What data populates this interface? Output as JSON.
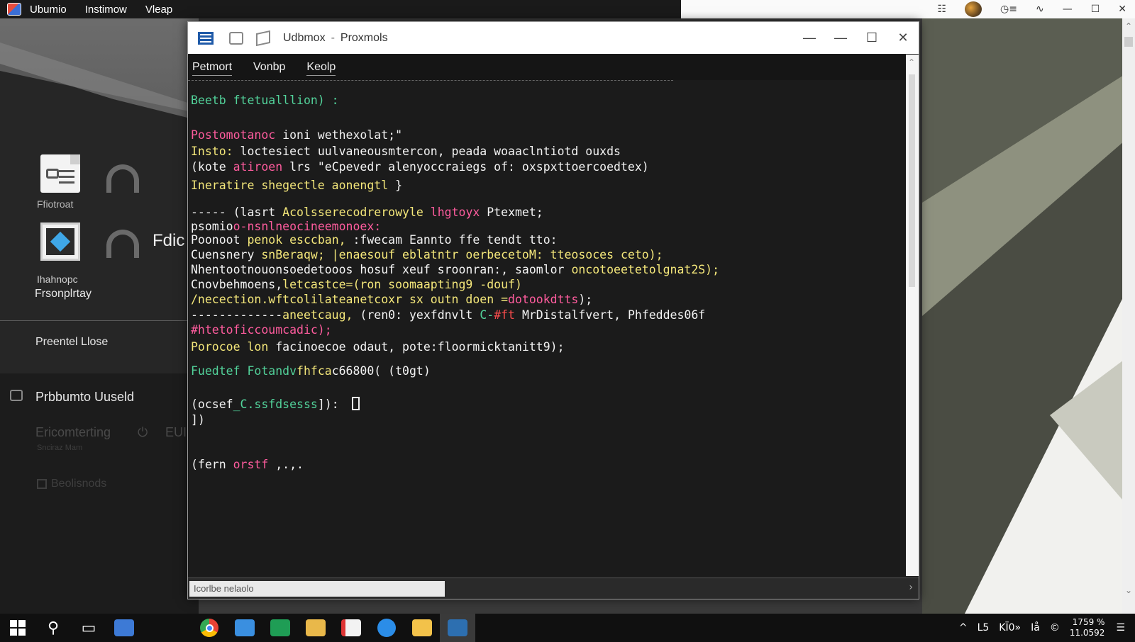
{
  "topbar": {
    "menus": [
      "Ubumio",
      "Instimow",
      "Vleap"
    ]
  },
  "desktop": {
    "icons": [
      {
        "label": "Ffiotroat"
      },
      {
        "label_line1": "Ihahnopc",
        "label_line2": "Frsonplrtay"
      }
    ],
    "side_text": "Fdic",
    "panel_item": "Preentel Llose",
    "section": {
      "title": "Prbbumto Uuseld",
      "dim_item": "Ericomterting",
      "dim_suffix": "EUI",
      "dim_sub": "Snciraz Mam",
      "dim_check": "Beolisnods"
    }
  },
  "window": {
    "title": "Udbmox",
    "separator": "-",
    "subtitle": "Proxmols",
    "menu": [
      "Petmort",
      "Vonbp",
      "Keolp"
    ],
    "status_field": "Icorlbe nelaolo",
    "terminal": {
      "lines": [
        [
          {
            "t": "Beetb ftetualllion) :",
            "c": "green"
          }
        ],
        [
          {
            "t": "Postomotanoc ",
            "c": "pink"
          },
          {
            "t": "ioni wethexolat;\"",
            "c": "white"
          }
        ],
        [
          {
            "t": "Insto: ",
            "c": "yellow"
          },
          {
            "t": "loctesiect uulvaneousmtercon, peada woaaclntiotd ouxds",
            "c": "white"
          }
        ],
        [
          {
            "t": "(kote ",
            "c": "white"
          },
          {
            "t": "atiroen ",
            "c": "pink"
          },
          {
            "t": "lrs \"eCpevedr alenyoccraiegs of: oxspxttoercoedtex)",
            "c": "white"
          }
        ],
        [
          {
            "t": "Ineratire shegectle aonengtl",
            "c": "yellow"
          },
          {
            "t": " }",
            "c": "white"
          }
        ],
        [
          {
            "t": "----- ",
            "c": "white"
          },
          {
            "t": "(lasrt ",
            "c": "white"
          },
          {
            "t": "Acolsserecodrerowyle ",
            "c": "yellow"
          },
          {
            "t": "lhgtoyx ",
            "c": "pink"
          },
          {
            "t": "Ptexmet;",
            "c": "white"
          }
        ],
        [
          {
            "t": "psomio",
            "c": "white"
          },
          {
            "t": "o-nsnlneocineemonoex:",
            "c": "pink"
          }
        ],
        [
          {
            "t": "Poonoot ",
            "c": "white"
          },
          {
            "t": "penok esccban, ",
            "c": "yellow"
          },
          {
            "t": ":fwecam Eannto ffe tendt tto:",
            "c": "white"
          }
        ],
        [
          {
            "t": "Cuensnery ",
            "c": "white"
          },
          {
            "t": "snBeraqw; |enaesouf eblatntr oerbecetoM: tteosoces ceto);",
            "c": "yellow"
          }
        ],
        [
          {
            "t": "Nhentootnouonsoedetooos hosuf xeuf sroonran:, saomlor ",
            "c": "white"
          },
          {
            "t": "oncotoeetetolgnat2S);",
            "c": "yellow"
          }
        ],
        [
          {
            "t": "Cnovbehmoens,",
            "c": "white"
          },
          {
            "t": "letcastce=(ron soomaapting9 -douf)",
            "c": "yellow"
          }
        ],
        [
          {
            "t": "/necection.wftcolilateanetcoxr sx outn doen =",
            "c": "yellow"
          },
          {
            "t": "dotookdtts",
            "c": "pink"
          },
          {
            "t": ");",
            "c": "white"
          }
        ],
        [
          {
            "t": "-------------",
            "c": "white"
          },
          {
            "t": "aneetcaug, ",
            "c": "yellow"
          },
          {
            "t": "(ren0: yexfdnvlt ",
            "c": "white"
          },
          {
            "t": "C-",
            "c": "green"
          },
          {
            "t": "#ft ",
            "c": "red"
          },
          {
            "t": "MrDistalfvert, Phfeddes06f",
            "c": "white"
          }
        ],
        [
          {
            "t": "#htetoficcoumcadic);",
            "c": "pink"
          }
        ],
        [
          {
            "t": "Porocoe lon ",
            "c": "yellow"
          },
          {
            "t": "facinoecoe odaut, pote:floormicktanitt9);",
            "c": "white"
          }
        ],
        [
          {
            "t": "Fuedtef Fotandv",
            "c": "green"
          },
          {
            "t": "fhfca",
            "c": "yellow"
          },
          {
            "t": "c66800( (t0gt)",
            "c": "white"
          }
        ],
        [
          {
            "t": "(ocsef",
            "c": "white"
          },
          {
            "t": "_C.ssfdsesss",
            "c": "green"
          },
          {
            "t": "]): ",
            "c": "white"
          }
        ],
        [
          {
            "t": "])",
            "c": "white"
          }
        ],
        [
          {
            "t": "(fern ",
            "c": "white"
          },
          {
            "t": "orstf",
            "c": "pink"
          },
          {
            "t": " ,.,.",
            "c": "white"
          }
        ]
      ]
    }
  },
  "tray_top": {
    "icons": [
      "clipboard-icon",
      "avatar-icon",
      "clock-settings-icon",
      "pulse-icon",
      "minimize-icon",
      "maximize-icon",
      "close-icon"
    ]
  },
  "taskbar": {
    "apps": [
      "start-icon",
      "search-icon",
      "task-view-icon",
      "user-app-icon",
      "chrome-icon",
      "folder-icon",
      "sheets-icon",
      "files-icon",
      "document-icon",
      "messenger-icon",
      "notes-icon",
      "terminal-app-icon"
    ],
    "tray": {
      "chevron": "^",
      "net1": "L5",
      "net2": "KÏ0»",
      "net3": "Iå",
      "vol": "©",
      "time": "1759 %",
      "date": "11.0592"
    }
  },
  "colors": {
    "terminal_bg": "#1b1b1b",
    "green": "#52d29a",
    "pink": "#ff5c9e",
    "yellow": "#f4e77a",
    "accent_blue": "#1f5aa8"
  }
}
